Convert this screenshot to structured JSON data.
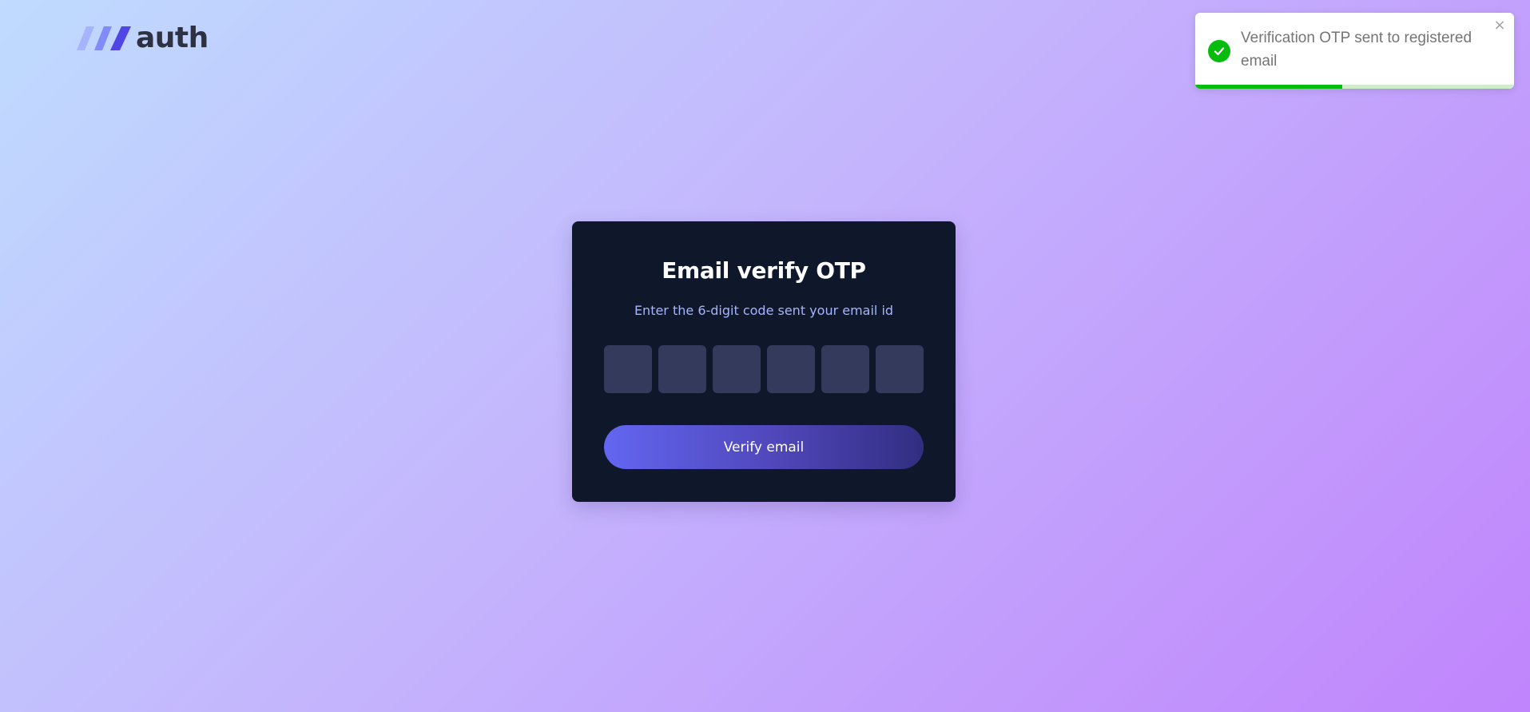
{
  "header": {
    "logo_text": "auth",
    "logo_icon": "slash-stripes-icon"
  },
  "toast": {
    "type": "success",
    "icon": "check-circle-icon",
    "message": "Verification OTP sent to registered email",
    "close_label": "×",
    "progress_remaining": 0.46,
    "colors": {
      "accent": "#07bc0c",
      "track": "#cdeec9"
    }
  },
  "card": {
    "title": "Email verify OTP",
    "subtitle": "Enter the 6-digit code sent your email id",
    "otp_digits": [
      "",
      "",
      "",
      "",
      "",
      ""
    ],
    "verify_button_label": "Verify email",
    "colors": {
      "background": "#0f172a",
      "subtitle": "#a5b4fc",
      "input": "#333a5c",
      "button_start": "#6366f1",
      "button_end": "#312e81"
    }
  }
}
